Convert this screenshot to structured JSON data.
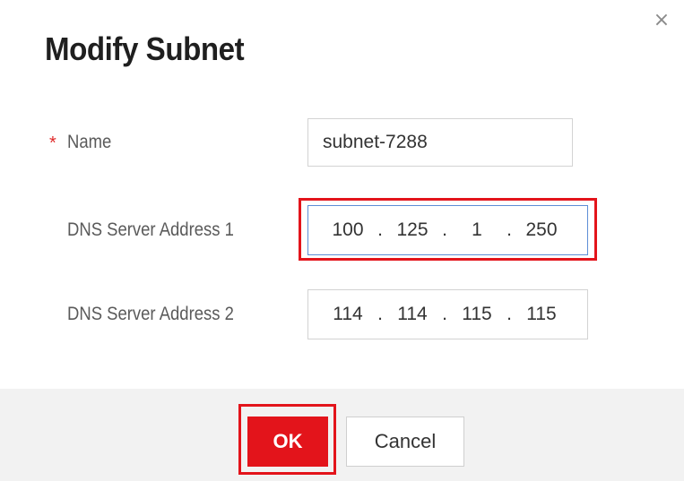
{
  "dialog": {
    "title": "Modify Subnet",
    "close_icon": "close-icon"
  },
  "form": {
    "name": {
      "label": "Name",
      "required_marker": "*",
      "value": "subnet-7288"
    },
    "dns1": {
      "label": "DNS Server Address 1",
      "octets": [
        "100",
        "125",
        "1",
        "250"
      ],
      "separator": "."
    },
    "dns2": {
      "label": "DNS Server Address 2",
      "octets": [
        "114",
        "114",
        "115",
        "115"
      ],
      "separator": "."
    }
  },
  "footer": {
    "ok_label": "OK",
    "cancel_label": "Cancel"
  },
  "colors": {
    "primary": "#e3141b",
    "focus_border": "#5e8ed6",
    "footer_bg": "#f2f2f2"
  }
}
